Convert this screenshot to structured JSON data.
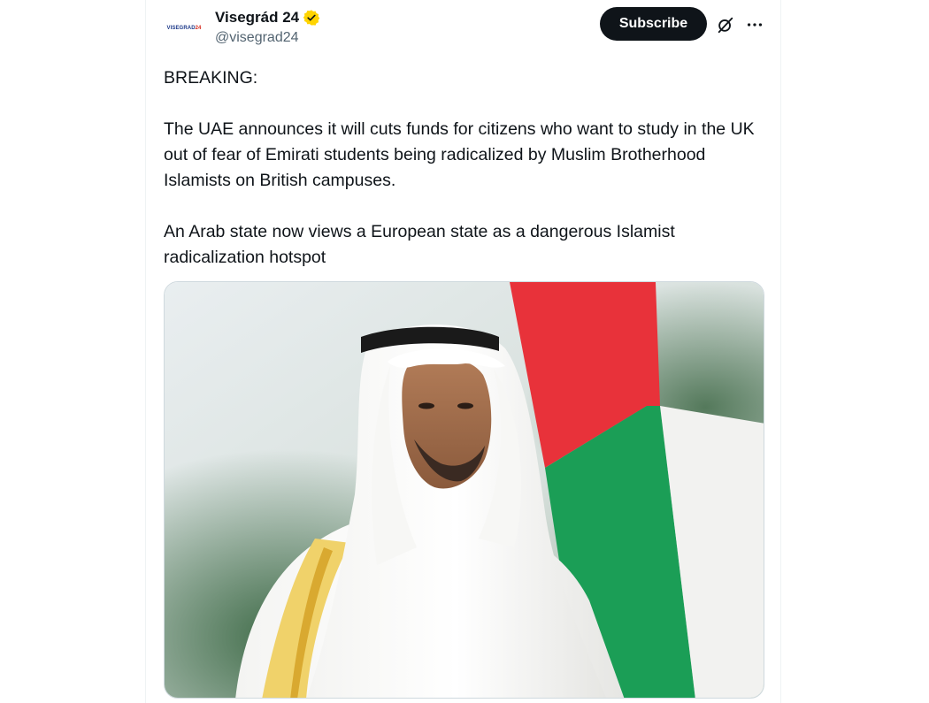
{
  "account": {
    "display_name": "Visegrád 24",
    "handle": "@visegrad24",
    "avatar_text": "VISEGRAD",
    "avatar_text_accent": "24",
    "verified_icon": "verified-badge-icon",
    "colors": {
      "verified": "#ffd400",
      "avatar_blue": "#1d3a8a",
      "avatar_red": "#d52b1e"
    }
  },
  "actions": {
    "subscribe_label": "Subscribe",
    "grok_icon": "grok-icon",
    "more_icon": "more-icon"
  },
  "tweet": {
    "line1": "BREAKING:",
    "line2": "The UAE announces it will cuts funds for citizens who want to study in the UK out of fear of Emirati students being radicalized by Muslim Brotherhood Islamists on British campuses.",
    "line3": "An Arab state now views a European state as a dangerous Islamist radicalization hotspot"
  },
  "media": {
    "image_icon": "photo-of-man-in-white-ghutra-with-uae-flag",
    "colors": {
      "flag_red": "#e8323a",
      "flag_green": "#1b9e56"
    }
  }
}
